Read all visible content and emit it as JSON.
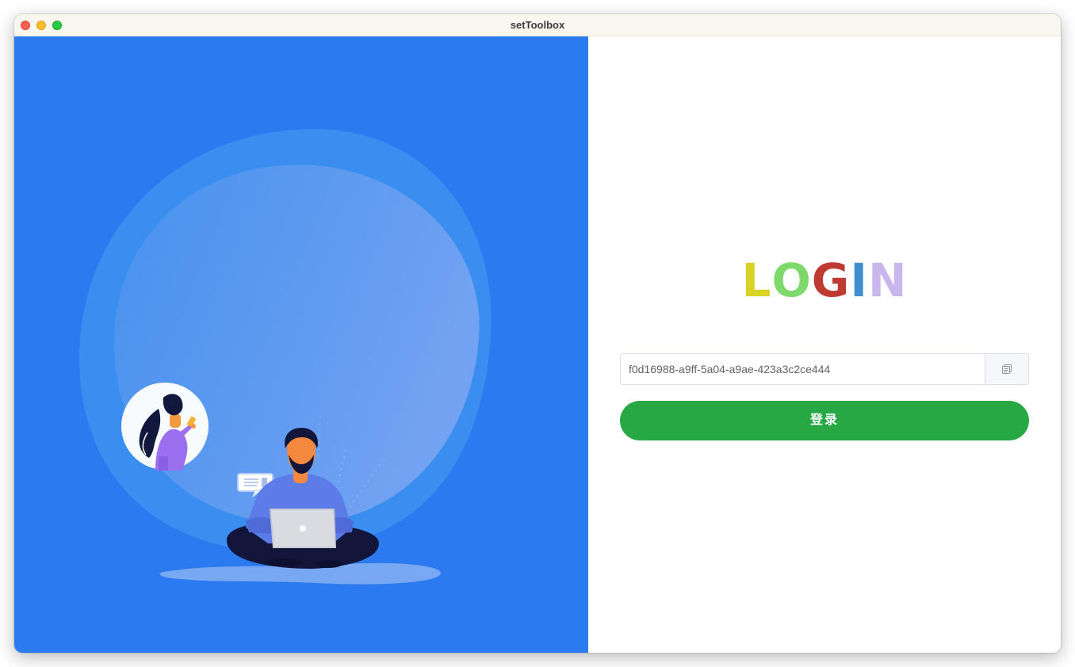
{
  "window": {
    "title": "setToolbox"
  },
  "login": {
    "heading_letters": [
      {
        "char": "L",
        "color": "#d8d324"
      },
      {
        "char": "O",
        "color": "#7ed86c"
      },
      {
        "char": "G",
        "color": "#c03a34"
      },
      {
        "char": "I",
        "color": "#3f8fcf"
      },
      {
        "char": "N",
        "color": "#c9b6ec"
      }
    ],
    "uuid_value": "f0d16988-a9ff-5a04-a9ae-423a3c2ce444",
    "copy_icon": "copy-icon",
    "submit_label": "登录"
  },
  "colors": {
    "left_panel_bg": "#2b7af0",
    "login_button": "#28a745"
  }
}
